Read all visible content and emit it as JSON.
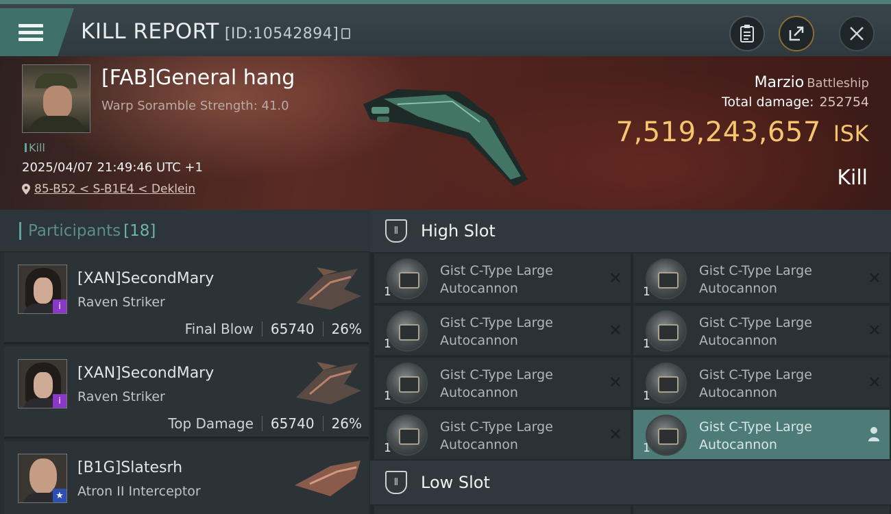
{
  "header": {
    "title": "KILL REPORT",
    "report_id": "[ID:10542894]",
    "icons": [
      "menu-icon",
      "copy-icon",
      "clipboard-icon",
      "share-icon",
      "close-icon"
    ]
  },
  "victim": {
    "name": "[FAB]General hang",
    "warp_scramble": "Warp Soramble Strength: 41.0",
    "tag": "Kill",
    "datetime": "2025/04/07 21:49:46 UTC +1",
    "location": "85-B52 < S-B1E4 < Deklein",
    "ship_name": "Marzio",
    "ship_class": "Battleship",
    "total_damage_label": "Total damage:",
    "total_damage": "252754",
    "isk_value": "7,519,243,657",
    "isk_unit": "ISK",
    "result": "Kill"
  },
  "participants": {
    "label": "Participants",
    "count": "[18]",
    "rows": [
      {
        "name": "[XAN]SecondMary",
        "ship": "Raven Striker",
        "role": "Final Blow",
        "damage": "65740",
        "percent": "26%"
      },
      {
        "name": "[XAN]SecondMary",
        "ship": "Raven Striker",
        "role": "Top Damage",
        "damage": "65740",
        "percent": "26%"
      },
      {
        "name": "[B1G]Slatesrh",
        "ship": "Atron II Interceptor"
      }
    ]
  },
  "slots": {
    "high": {
      "title": "High Slot",
      "items": [
        {
          "qty": "1",
          "name_l1": "Gist C-Type Large",
          "name_l2": "Autocannon"
        },
        {
          "qty": "1",
          "name_l1": "Gist C-Type Large",
          "name_l2": "Autocannon"
        },
        {
          "qty": "1",
          "name_l1": "Gist C-Type Large",
          "name_l2": "Autocannon"
        },
        {
          "qty": "1",
          "name_l1": "Gist C-Type Large",
          "name_l2": "Autocannon"
        },
        {
          "qty": "1",
          "name_l1": "Gist C-Type Large",
          "name_l2": "Autocannon"
        },
        {
          "qty": "1",
          "name_l1": "Gist C-Type Large",
          "name_l2": "Autocannon"
        },
        {
          "qty": "1",
          "name_l1": "Gist C-Type Large",
          "name_l2": "Autocannon"
        },
        {
          "qty": "1",
          "name_l1": "Gist C-Type Large",
          "name_l2": "Autocannon"
        }
      ]
    },
    "low": {
      "title": "Low Slot"
    }
  },
  "colors": {
    "accent": "#5fa59b",
    "isk": "#f5c66e",
    "active_item": "#4d7b77"
  }
}
